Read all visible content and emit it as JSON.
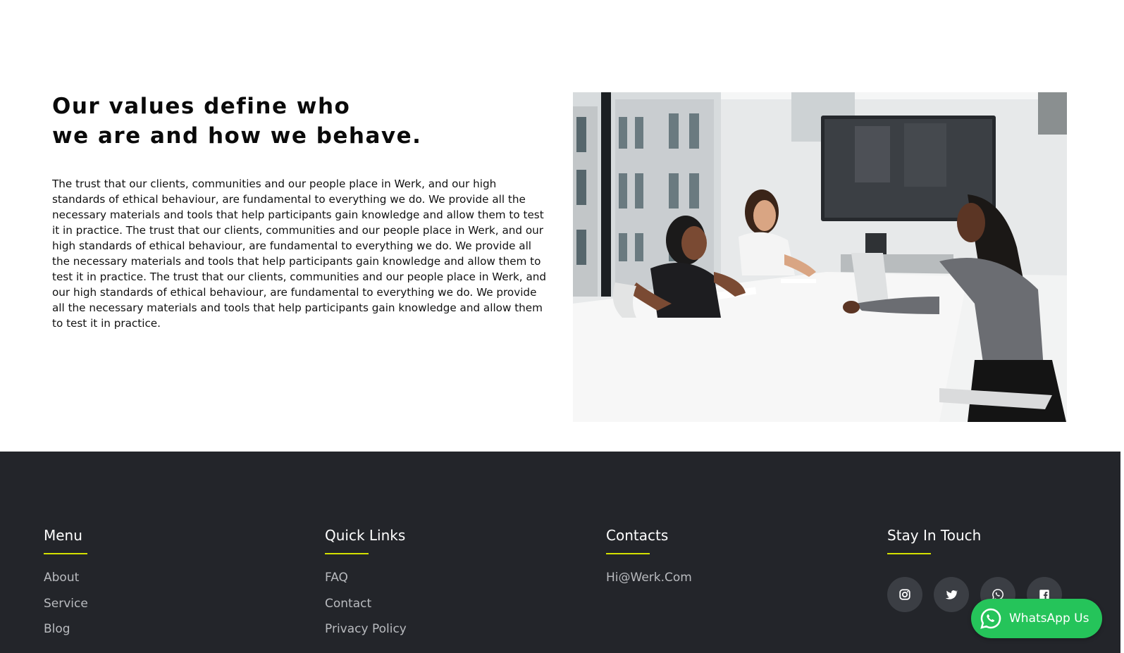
{
  "values": {
    "heading_line1": "Our values define who",
    "heading_line2": "we are and how we behave.",
    "body": "The trust that our clients, communities and our people place in Werk, and our high standards of ethical behaviour, are fundamental to everything we do. We provide all the necessary materials and tools that help participants gain knowledge and allow them to test it in practice. The trust that our clients, communities and our people place in Werk, and our high standards of ethical behaviour, are fundamental to everything we do. We provide all the necessary materials and tools that help participants gain knowledge and allow them to test it in practice. The trust that our clients, communities and our people place in Werk, and our high standards of ethical behaviour, are fundamental to everything we do. We provide all the necessary materials and tools that help participants gain knowledge and allow them to test it in practice."
  },
  "footer": {
    "menu": {
      "title": "Menu",
      "items": [
        "About",
        "Service",
        "Blog"
      ]
    },
    "quick_links": {
      "title": "Quick Links",
      "items": [
        "FAQ",
        "Contact",
        "Privacy Policy"
      ]
    },
    "contacts": {
      "title": "Contacts",
      "email": "Hi@Werk.Com"
    },
    "stay_in_touch": {
      "title": "Stay In Touch",
      "icons": [
        "instagram-icon",
        "twitter-icon",
        "whatsapp-icon",
        "facebook-icon"
      ]
    }
  },
  "whatsapp_button": {
    "label": "WhatsApp Us"
  },
  "colors": {
    "footer_bg": "#23252a",
    "accent_underline": "#d4e000",
    "whatsapp_green": "#25c45a",
    "top_border": "#b5485e"
  }
}
